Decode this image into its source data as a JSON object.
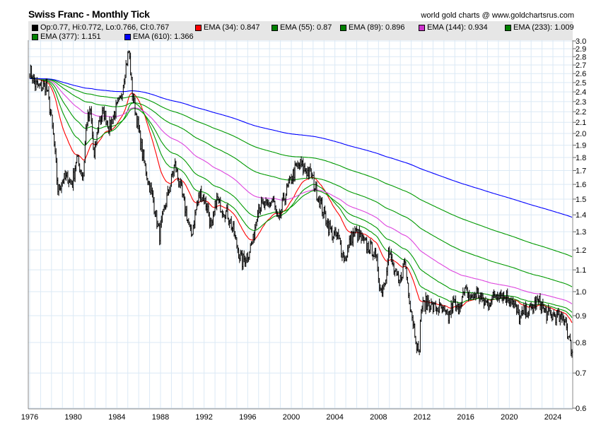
{
  "header": {
    "title": "Swiss Franc - Monthly Tick",
    "credit": "world gold charts @ www.goldchartsrus.com"
  },
  "legend": [
    {
      "label": "Op:0.77, Hi:0.772, Lo:0.766, Cl:0.767",
      "color": "#000000"
    },
    {
      "label": "EMA (34): 0.847",
      "color": "#ff0000"
    },
    {
      "label": "EMA (55): 0.87",
      "color": "#008000"
    },
    {
      "label": "EMA (89): 0.896",
      "color": "#008000"
    },
    {
      "label": "EMA (144): 0.934",
      "color": "#cc33cc"
    },
    {
      "label": "EMA (233): 1.009",
      "color": "#008000"
    },
    {
      "label": "EMA (377): 1.151",
      "color": "#008000"
    },
    {
      "label": "EMA (610): 1.366",
      "color": "#0000ff"
    }
  ],
  "chart_data": {
    "type": "line",
    "title": "Swiss Franc - Monthly Tick",
    "scale": "log",
    "ylim": [
      0.6,
      3.0
    ],
    "xlim": [
      1976,
      2025.8
    ],
    "y_ticks": [
      "0.6",
      "0.7",
      "0.8",
      "0.9",
      "1.0",
      "1.1",
      "1.2",
      "1.3",
      "1.4",
      "1.5",
      "1.6",
      "1.7",
      "1.8",
      "1.9",
      "2.0",
      "2.1",
      "2.2",
      "2.3",
      "2.4",
      "2.5",
      "2.6",
      "2.7",
      "2.8",
      "2.9",
      "3.0"
    ],
    "x_ticks": [
      "1976",
      "1980",
      "1984",
      "1988",
      "1992",
      "1996",
      "2000",
      "2004",
      "2008",
      "2012",
      "2016",
      "2020",
      "2024"
    ],
    "ema_periods": [
      34,
      55,
      89,
      144,
      233,
      377,
      610
    ],
    "ema_colors": [
      "#ff0000",
      "#009900",
      "#009900",
      "#dd44dd",
      "#009900",
      "#009900",
      "#0000ff"
    ],
    "price_keypoints": [
      [
        1976.0,
        2.65
      ],
      [
        1976.5,
        2.48
      ],
      [
        1977.0,
        2.45
      ],
      [
        1977.5,
        2.47
      ],
      [
        1977.9,
        2.2
      ],
      [
        1978.2,
        1.95
      ],
      [
        1978.6,
        1.55
      ],
      [
        1978.9,
        1.62
      ],
      [
        1979.5,
        1.65
      ],
      [
        1979.9,
        1.6
      ],
      [
        1980.3,
        1.8
      ],
      [
        1980.9,
        1.65
      ],
      [
        1981.2,
        2.1
      ],
      [
        1981.6,
        2.2
      ],
      [
        1981.9,
        1.78
      ],
      [
        1982.3,
        2.1
      ],
      [
        1982.8,
        2.2
      ],
      [
        1983.3,
        2.05
      ],
      [
        1983.8,
        2.2
      ],
      [
        1984.3,
        2.3
      ],
      [
        1984.7,
        2.6
      ],
      [
        1985.1,
        2.88
      ],
      [
        1985.4,
        2.4
      ],
      [
        1985.8,
        2.15
      ],
      [
        1986.3,
        1.85
      ],
      [
        1986.8,
        1.65
      ],
      [
        1987.3,
        1.5
      ],
      [
        1987.9,
        1.28
      ],
      [
        1988.4,
        1.45
      ],
      [
        1988.9,
        1.6
      ],
      [
        1989.3,
        1.75
      ],
      [
        1989.9,
        1.55
      ],
      [
        1990.4,
        1.4
      ],
      [
        1990.8,
        1.27
      ],
      [
        1991.3,
        1.45
      ],
      [
        1991.7,
        1.55
      ],
      [
        1992.3,
        1.45
      ],
      [
        1992.7,
        1.3
      ],
      [
        1993.1,
        1.5
      ],
      [
        1993.6,
        1.45
      ],
      [
        1994.2,
        1.4
      ],
      [
        1994.7,
        1.3
      ],
      [
        1995.2,
        1.18
      ],
      [
        1995.5,
        1.14
      ],
      [
        1996.0,
        1.18
      ],
      [
        1996.5,
        1.25
      ],
      [
        1996.9,
        1.45
      ],
      [
        1997.4,
        1.45
      ],
      [
        1997.8,
        1.45
      ],
      [
        1998.3,
        1.5
      ],
      [
        1998.8,
        1.35
      ],
      [
        1999.3,
        1.5
      ],
      [
        1999.8,
        1.6
      ],
      [
        2000.3,
        1.7
      ],
      [
        2000.8,
        1.75
      ],
      [
        2001.3,
        1.7
      ],
      [
        2001.8,
        1.68
      ],
      [
        2002.3,
        1.55
      ],
      [
        2002.8,
        1.45
      ],
      [
        2003.3,
        1.35
      ],
      [
        2003.8,
        1.28
      ],
      [
        2004.3,
        1.27
      ],
      [
        2004.9,
        1.15
      ],
      [
        2005.5,
        1.27
      ],
      [
        2005.9,
        1.3
      ],
      [
        2006.5,
        1.25
      ],
      [
        2007.0,
        1.22
      ],
      [
        2007.5,
        1.2
      ],
      [
        2007.9,
        1.12
      ],
      [
        2008.2,
        1.0
      ],
      [
        2008.6,
        1.05
      ],
      [
        2008.9,
        1.2
      ],
      [
        2009.4,
        1.1
      ],
      [
        2009.9,
        1.03
      ],
      [
        2010.4,
        1.15
      ],
      [
        2010.9,
        0.95
      ],
      [
        2011.5,
        0.8
      ],
      [
        2011.7,
        0.75
      ],
      [
        2011.9,
        0.93
      ],
      [
        2012.5,
        0.96
      ],
      [
        2013.0,
        0.93
      ],
      [
        2013.6,
        0.93
      ],
      [
        2014.4,
        0.89
      ],
      [
        2014.9,
        0.96
      ],
      [
        2015.2,
        0.92
      ],
      [
        2015.6,
        0.97
      ],
      [
        2016.0,
        1.0
      ],
      [
        2016.6,
        0.97
      ],
      [
        2017.0,
        1.0
      ],
      [
        2017.5,
        0.96
      ],
      [
        2018.0,
        0.95
      ],
      [
        2018.6,
        0.98
      ],
      [
        2019.0,
        1.0
      ],
      [
        2019.6,
        0.98
      ],
      [
        2020.2,
        0.97
      ],
      [
        2020.6,
        0.92
      ],
      [
        2021.0,
        0.89
      ],
      [
        2021.5,
        0.92
      ],
      [
        2022.0,
        0.92
      ],
      [
        2022.5,
        0.96
      ],
      [
        2022.9,
        0.95
      ],
      [
        2023.3,
        0.91
      ],
      [
        2023.8,
        0.9
      ],
      [
        2024.3,
        0.9
      ],
      [
        2024.8,
        0.88
      ],
      [
        2025.1,
        0.9
      ],
      [
        2025.4,
        0.82
      ],
      [
        2025.6,
        0.79
      ],
      [
        2025.8,
        0.767
      ]
    ]
  }
}
